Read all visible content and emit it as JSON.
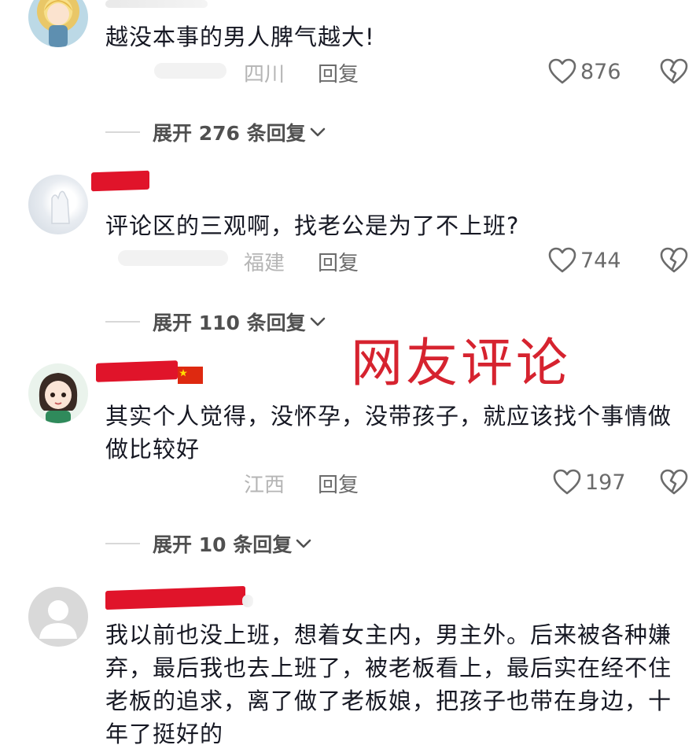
{
  "comments": [
    {
      "text": "越没本事的男人脾气越大!",
      "location": "四川",
      "reply_label": "回复",
      "likes": "876",
      "expand_label": "展开 276 条回复"
    },
    {
      "text": "评论区的三观啊，找老公是为了不上班?",
      "location": "福建",
      "reply_label": "回复",
      "likes": "744",
      "expand_label": "展开 110 条回复"
    },
    {
      "text": "其实个人觉得，没怀孕，没带孩子，就应该找个事情做做比较好",
      "location": "江西",
      "reply_label": "回复",
      "likes": "197",
      "expand_label": "展开 10 条回复"
    },
    {
      "text": "我以前也没上班，想着女主内，男主外。后来被各种嫌弃，最后我也去上班了，被老板看上，最后实在经不住老板的追求，离了做了老板娘，把孩子也带在身边，十年了挺好的"
    }
  ],
  "overlay": {
    "title": "网友评论"
  },
  "colors": {
    "accent_red": "#d6232f",
    "redaction": "#e0142a"
  },
  "icons": [
    "heart-outline-icon",
    "broken-heart-icon",
    "chevron-down-icon",
    "default-avatar-icon"
  ]
}
